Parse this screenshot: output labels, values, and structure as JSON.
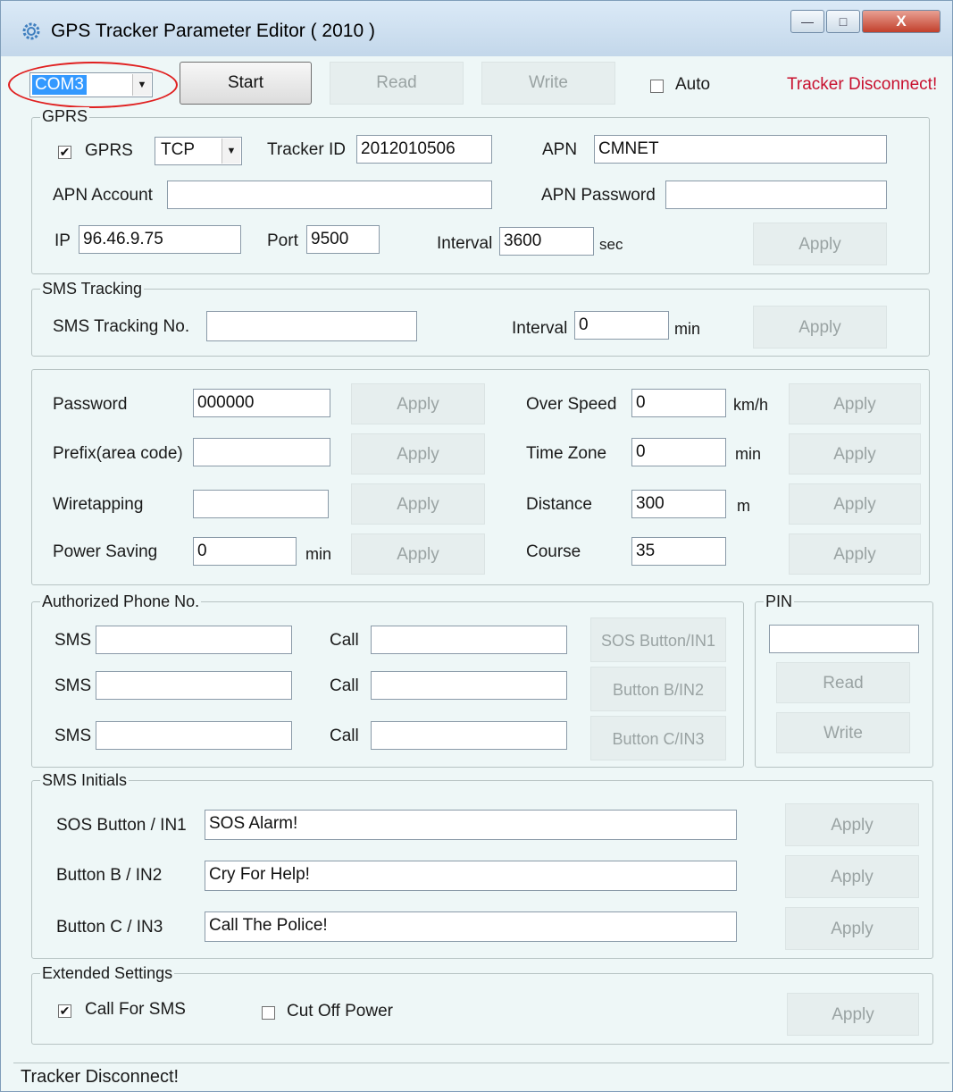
{
  "window": {
    "title": "GPS Tracker Parameter Editor ( 2010 )",
    "minimize": "—",
    "maximize": "□",
    "close": "X"
  },
  "toolbar": {
    "port_value": "COM3",
    "start_label": "Start",
    "read_label": "Read",
    "write_label": "Write",
    "auto_label": "Auto",
    "status_label": "Tracker Disconnect!"
  },
  "gprs": {
    "group_label": "GPRS",
    "gprs_label": "GPRS",
    "gprs_checked": "✔",
    "protocol_value": "TCP",
    "tracker_id_label": "Tracker ID",
    "tracker_id_value": "2012010506",
    "apn_label": "APN",
    "apn_value": "CMNET",
    "apn_account_label": "APN Account",
    "apn_account_value": "",
    "apn_password_label": "APN Password",
    "apn_password_value": "",
    "ip_label": "IP",
    "ip_value": "96.46.9.75",
    "port_label": "Port",
    "port_value": "9500",
    "interval_label": "Interval",
    "interval_value": "3600",
    "interval_unit": "sec",
    "apply_label": "Apply"
  },
  "sms_tracking": {
    "group_label": "SMS Tracking",
    "number_label": "SMS Tracking No.",
    "number_value": "",
    "interval_label": "Interval",
    "interval_value": "0",
    "interval_unit": "min",
    "apply_label": "Apply"
  },
  "params": {
    "password_label": "Password",
    "password_value": "000000",
    "prefix_label": "Prefix(area code)",
    "prefix_value": "",
    "wiretapping_label": "Wiretapping",
    "wiretapping_value": "",
    "power_saving_label": "Power Saving",
    "power_saving_value": "0",
    "power_saving_unit": "min",
    "over_speed_label": "Over Speed",
    "over_speed_value": "0",
    "over_speed_unit": "km/h",
    "time_zone_label": "Time Zone",
    "time_zone_value": "0",
    "time_zone_unit": "min",
    "distance_label": "Distance",
    "distance_value": "300",
    "distance_unit": "m",
    "course_label": "Course",
    "course_value": "35",
    "apply_label": "Apply"
  },
  "authorized": {
    "group_label": "Authorized Phone No.",
    "sms_label": "SMS",
    "call_label": "Call",
    "sms_values": [
      "",
      "",
      ""
    ],
    "call_values": [
      "",
      "",
      ""
    ],
    "buttons": [
      "SOS Button/IN1",
      "Button B/IN2",
      "Button C/IN3"
    ]
  },
  "pin": {
    "group_label": "PIN",
    "value": "",
    "read_label": "Read",
    "write_label": "Write"
  },
  "sms_initials": {
    "group_label": "SMS Initials",
    "rows": [
      {
        "label": "SOS Button / IN1",
        "value": "SOS Alarm!"
      },
      {
        "label": "Button B / IN2",
        "value": "Cry For Help!"
      },
      {
        "label": "Button C / IN3",
        "value": "Call The Police!"
      }
    ],
    "apply_label": "Apply"
  },
  "extended": {
    "group_label": "Extended Settings",
    "call_for_sms_label": "Call For SMS",
    "call_for_sms_checked": "✔",
    "cut_off_power_label": "Cut Off Power",
    "apply_label": "Apply"
  },
  "statusbar": {
    "text": "Tracker Disconnect!"
  },
  "colors": {
    "window_bg": "#eef7f7",
    "status_red": "#c8102e",
    "highlight_blue": "#3399ff",
    "annotation_red": "#e02020"
  }
}
